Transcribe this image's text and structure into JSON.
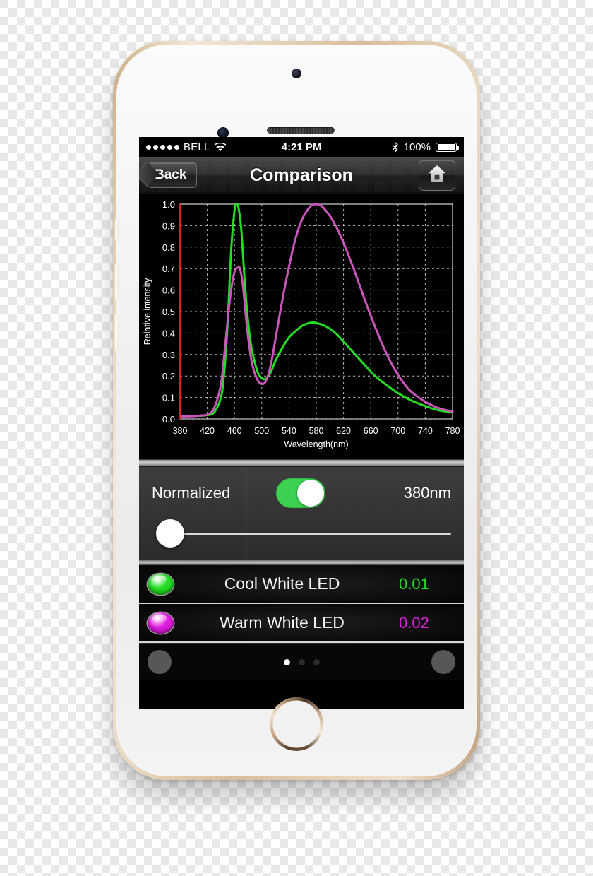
{
  "status_bar": {
    "signal_dots": 5,
    "carrier": "BELL",
    "wifi_icon": "wifi-icon",
    "time": "4:21 PM",
    "bluetooth_icon": "bluetooth-icon",
    "battery_percent": "100%",
    "battery_icon": "battery-full-icon"
  },
  "nav_bar": {
    "back_label": "Back",
    "title": "Comparison",
    "home_icon": "home-icon"
  },
  "controls": {
    "toggle_label": "Normalized",
    "toggle_state": "on",
    "toggle_color": "#3cd150",
    "wavelength_value": "380nm",
    "slider_position_percent": 0
  },
  "measurements": [
    {
      "name": "Cool White LED",
      "value": "0.01",
      "color": "#22dd22"
    },
    {
      "name": "Warm White LED",
      "value": "0.02",
      "color": "#e21ce2"
    }
  ],
  "bottom_bar": {
    "left_button": "left-round-button",
    "right_button": "right-round-button",
    "page_dots": 3,
    "active_dot_index": 0
  },
  "chart_data": {
    "type": "line",
    "title": "",
    "xlabel": "Wavelength(nm)",
    "ylabel": "Relative intensity",
    "xlim": [
      380,
      780
    ],
    "ylim": [
      0.0,
      1.0
    ],
    "xticks": [
      380,
      420,
      460,
      500,
      540,
      580,
      620,
      660,
      700,
      740,
      780
    ],
    "yticks": [
      0.0,
      0.1,
      0.2,
      0.3,
      0.4,
      0.5,
      0.6,
      0.7,
      0.8,
      0.9,
      1.0
    ],
    "grid": true,
    "background": "#000000",
    "legend": "none",
    "cursor_line": {
      "x": 380,
      "color": "#e02020"
    },
    "series": [
      {
        "name": "Cool White LED",
        "color": "#22dd22",
        "x": [
          380,
          390,
          400,
          410,
          420,
          430,
          440,
          445,
          450,
          455,
          460,
          463,
          466,
          470,
          475,
          480,
          485,
          490,
          495,
          500,
          505,
          510,
          515,
          520,
          530,
          540,
          550,
          560,
          570,
          575,
          580,
          590,
          600,
          610,
          620,
          630,
          640,
          650,
          660,
          670,
          680,
          700,
          720,
          740,
          760,
          780
        ],
        "y": [
          0.015,
          0.015,
          0.015,
          0.015,
          0.018,
          0.03,
          0.1,
          0.22,
          0.45,
          0.78,
          0.97,
          1.0,
          0.98,
          0.88,
          0.64,
          0.45,
          0.33,
          0.26,
          0.21,
          0.19,
          0.185,
          0.2,
          0.23,
          0.27,
          0.33,
          0.38,
          0.41,
          0.435,
          0.447,
          0.449,
          0.447,
          0.437,
          0.42,
          0.395,
          0.36,
          0.325,
          0.29,
          0.255,
          0.22,
          0.19,
          0.165,
          0.12,
          0.085,
          0.06,
          0.04,
          0.03
        ]
      },
      {
        "name": "Warm White LED",
        "color": "#cc55bb",
        "x": [
          380,
          390,
          400,
          410,
          420,
          430,
          440,
          445,
          450,
          455,
          460,
          465,
          468,
          472,
          476,
          480,
          485,
          490,
          495,
          500,
          505,
          510,
          515,
          520,
          530,
          540,
          550,
          560,
          570,
          575,
          580,
          585,
          590,
          600,
          610,
          620,
          630,
          640,
          650,
          660,
          670,
          680,
          690,
          700,
          710,
          720,
          740,
          760,
          780
        ],
        "y": [
          0.012,
          0.012,
          0.013,
          0.016,
          0.02,
          0.05,
          0.16,
          0.3,
          0.46,
          0.6,
          0.685,
          0.705,
          0.7,
          0.63,
          0.5,
          0.38,
          0.27,
          0.21,
          0.175,
          0.163,
          0.17,
          0.21,
          0.28,
          0.37,
          0.55,
          0.71,
          0.845,
          0.935,
          0.985,
          0.998,
          1.0,
          0.997,
          0.985,
          0.945,
          0.89,
          0.82,
          0.74,
          0.655,
          0.565,
          0.48,
          0.4,
          0.325,
          0.26,
          0.205,
          0.16,
          0.125,
          0.08,
          0.05,
          0.035
        ]
      }
    ]
  }
}
